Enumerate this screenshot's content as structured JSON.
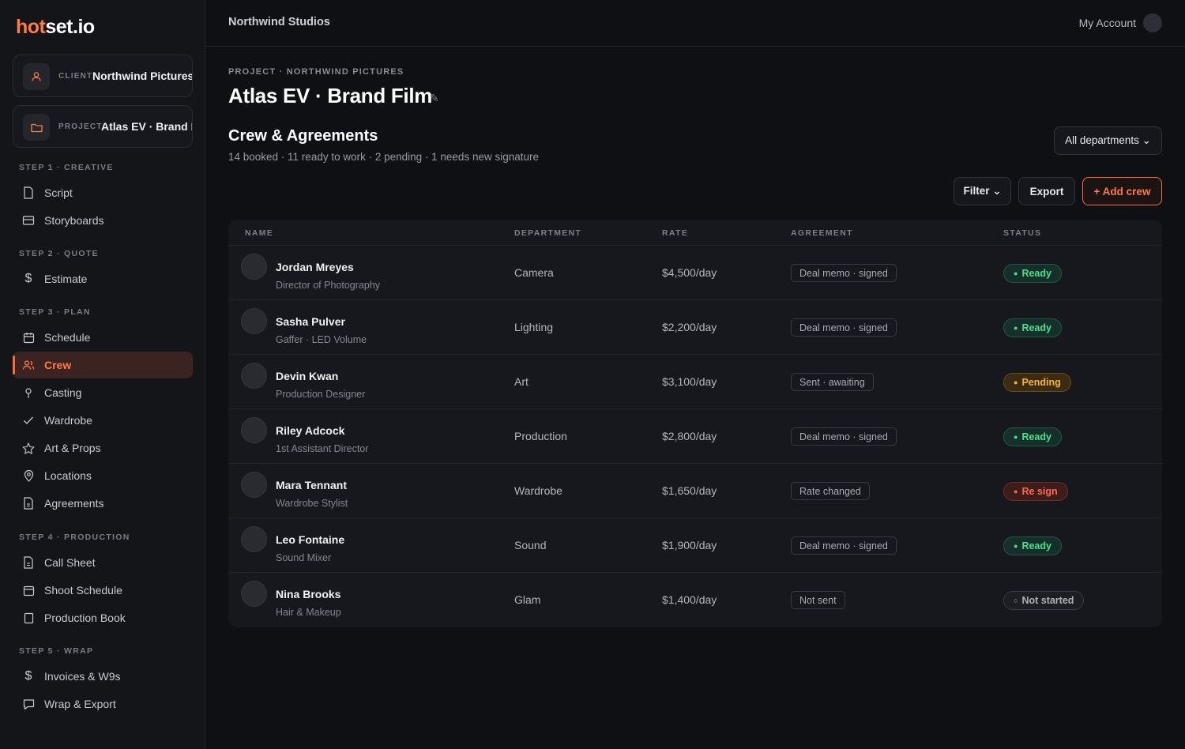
{
  "brand": {
    "logo_a": "hot",
    "logo_b": "set.io",
    "accent": "#ff6a3a"
  },
  "context": {
    "client_label": "CLIENT",
    "client_value": "Northwind Pictures",
    "project_label": "PROJECT",
    "project_value": "Atlas EV · Brand Film"
  },
  "sidebar": {
    "steps": [
      {
        "title": "STEP 1 · CREATIVE",
        "items": [
          {
            "label": "Script",
            "icon": "file-icon"
          },
          {
            "label": "Storyboards",
            "icon": "storyboard-icon"
          }
        ]
      },
      {
        "title": "STEP 2 · QUOTE",
        "items": [
          {
            "label": "Estimate",
            "icon": "dollar-icon"
          }
        ]
      },
      {
        "title": "STEP 3 · PLAN",
        "items": [
          {
            "label": "Schedule",
            "icon": "calendar-icon"
          },
          {
            "label": "Crew",
            "icon": "users-icon",
            "active": true
          },
          {
            "label": "Casting",
            "icon": "pin-icon"
          },
          {
            "label": "Wardrobe",
            "icon": "check-icon"
          },
          {
            "label": "Art & Props",
            "icon": "star-icon"
          },
          {
            "label": "Locations",
            "icon": "location-icon"
          },
          {
            "label": "Agreements",
            "icon": "document-icon"
          }
        ]
      },
      {
        "title": "STEP 4 · PRODUCTION",
        "items": [
          {
            "label": "Call Sheet",
            "icon": "document-icon"
          },
          {
            "label": "Shoot Schedule",
            "icon": "calendar-icon"
          },
          {
            "label": "Production Book",
            "icon": "book-icon"
          }
        ]
      },
      {
        "title": "STEP 5 · WRAP",
        "items": [
          {
            "label": "Invoices & W9s",
            "icon": "dollar-icon"
          },
          {
            "label": "Wrap & Export",
            "icon": "chat-icon"
          }
        ]
      }
    ]
  },
  "topbar": {
    "org": "Northwind Studios",
    "account": "My Account"
  },
  "header": {
    "breadcrumb": "PROJECT · NORTHWIND PICTURES",
    "title": "Atlas EV · Brand Film",
    "section_title": "Crew & Agreements",
    "section_sub": "14 booked · 11 ready to work · 2 pending · 1 needs new signature"
  },
  "toolbar": {
    "department": "All departments ⌄",
    "filter": "Filter ⌄",
    "export": "Export",
    "add": "+ Add crew"
  },
  "table": {
    "columns": [
      "NAME",
      "DEPARTMENT",
      "RATE",
      "AGREEMENT",
      "STATUS"
    ],
    "rows": [
      {
        "name": "Jordan Mreyes",
        "role": "Director of Photography",
        "department": "Camera",
        "rate": "$4,500/day",
        "agreement": "Deal memo · signed",
        "status": "Ready",
        "status_kind": "ready"
      },
      {
        "name": "Sasha Pulver",
        "role": "Gaffer · LED Volume",
        "department": "Lighting",
        "rate": "$2,200/day",
        "agreement": "Deal memo · signed",
        "status": "Ready",
        "status_kind": "ready"
      },
      {
        "name": "Devin Kwan",
        "role": "Production Designer",
        "department": "Art",
        "rate": "$3,100/day",
        "agreement": "Sent · awaiting",
        "status": "Pending",
        "status_kind": "pending"
      },
      {
        "name": "Riley Adcock",
        "role": "1st Assistant Director",
        "department": "Production",
        "rate": "$2,800/day",
        "agreement": "Deal memo · signed",
        "status": "Ready",
        "status_kind": "ready"
      },
      {
        "name": "Mara Tennant",
        "role": "Wardrobe Stylist",
        "department": "Wardrobe",
        "rate": "$1,650/day",
        "agreement": "Rate changed",
        "status": "Re sign",
        "status_kind": "resign"
      },
      {
        "name": "Leo Fontaine",
        "role": "Sound Mixer",
        "department": "Sound",
        "rate": "$1,900/day",
        "agreement": "Deal memo · signed",
        "status": "Ready",
        "status_kind": "ready"
      },
      {
        "name": "Nina Brooks",
        "role": "Hair & Makeup",
        "department": "Glam",
        "rate": "$1,400/day",
        "agreement": "Not sent",
        "status": "Not started",
        "status_kind": "none"
      }
    ]
  }
}
